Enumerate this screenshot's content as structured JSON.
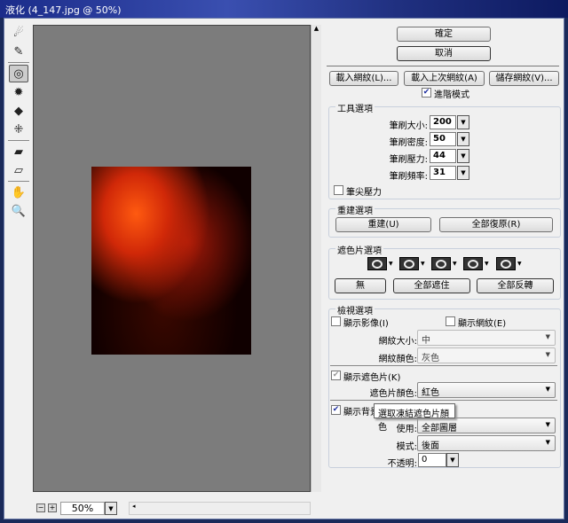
{
  "title": "液化 (4_147.jpg @ 50%)",
  "tools": [
    {
      "name": "forward-warp"
    },
    {
      "name": "reconstruct"
    },
    {
      "name": "twirl",
      "selected": true
    },
    {
      "name": "pucker"
    },
    {
      "name": "bloat"
    },
    {
      "name": "push-left"
    },
    {
      "name": "freeze-mask"
    },
    {
      "name": "thaw-mask"
    },
    {
      "name": "hand"
    },
    {
      "name": "zoom"
    }
  ],
  "buttons": {
    "ok": "確定",
    "cancel": "取消",
    "load_mesh": "載入網紋(L)...",
    "load_last": "載入上次網紋(A)",
    "save_mesh": "儲存網紋(V)..."
  },
  "advanced_mode": {
    "label": "進階模式",
    "checked": true
  },
  "tool_options": {
    "title": "工具選項",
    "brush_size_label": "筆刷大小:",
    "brush_size": "200",
    "brush_density_label": "筆刷密度:",
    "brush_density": "50",
    "brush_pressure_label": "筆刷壓力:",
    "brush_pressure": "44",
    "brush_rate_label": "筆刷頻率:",
    "brush_rate": "31",
    "stylus_label": "筆尖壓力",
    "stylus_checked": false
  },
  "reconstruct_options": {
    "title": "重建選項",
    "reconstruct": "重建(U)",
    "restore_all": "全部復原(R)"
  },
  "mask_options": {
    "title": "遮色片選項",
    "none": "無",
    "mask_all": "全部遮住",
    "invert_all": "全部反轉"
  },
  "view_options": {
    "title": "檢視選項",
    "show_image": "顯示影像(I)",
    "show_image_checked": false,
    "show_mesh": "顯示網紋(E)",
    "show_mesh_checked": false,
    "mesh_size_label": "網紋大小:",
    "mesh_size": "中",
    "mesh_color_label": "網紋顏色:",
    "mesh_color": "灰色",
    "show_mask": "顯示遮色片(K)",
    "show_mask_checked": true,
    "mask_color_label": "遮色片顏色:",
    "mask_color": "紅色",
    "show_backdrop": "顯示背景",
    "show_backdrop_checked": true,
    "use_label": "使用:",
    "use": "全部圖層",
    "mode_label": "模式:",
    "mode": "後面",
    "opacity_label": "不透明:",
    "opacity": "0"
  },
  "tooltip": "選取凍結遮色片顏色",
  "zoom": "50%"
}
